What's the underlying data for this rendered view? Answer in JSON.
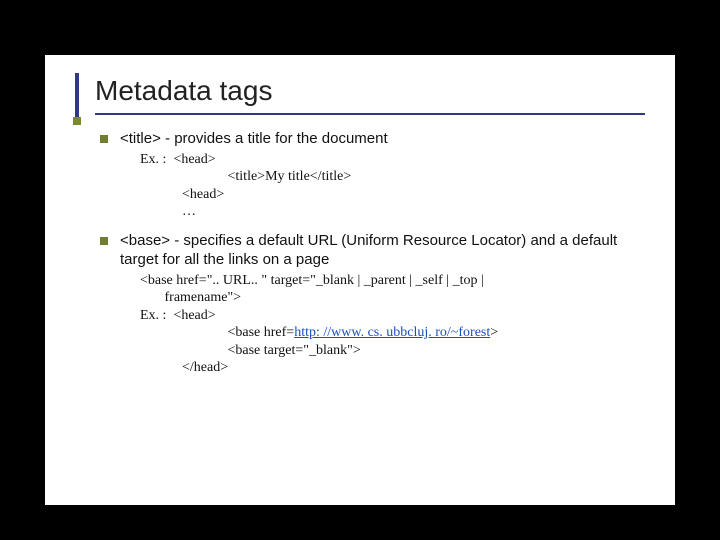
{
  "title": "Metadata tags",
  "bullet1": {
    "text": "<title> - provides a title for the document",
    "example": {
      "l1": "Ex. :  <head>",
      "l2": "                         <title>My title</title>",
      "l3": "            <head>",
      "l4": "            …"
    }
  },
  "bullet2": {
    "text": "<base> - specifies a default URL (Uniform Resource Locator) and a default target for all the links on a page",
    "example": {
      "l1": "<base href=\".. URL.. \" target=\"_blank | _parent | _self | _top |",
      "l2": "       framename\">",
      "l3": "Ex. :  <head>",
      "l4pre": "                         <base href=",
      "l4link": "http: //www. cs. ubbcluj. ro/~forest",
      "l4post": ">",
      "l5": "                         <base target=\"_blank\">",
      "l6": "            </head>"
    }
  }
}
